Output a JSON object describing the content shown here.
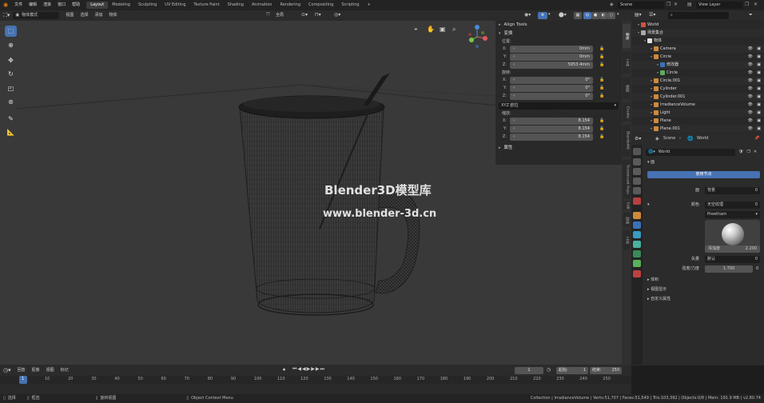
{
  "topbar": {
    "menus": [
      "文件",
      "编辑",
      "渲染",
      "窗口",
      "帮助"
    ],
    "workspaces": [
      "Layout",
      "Modeling",
      "Sculpting",
      "UV Editing",
      "Texture Paint",
      "Shading",
      "Animation",
      "Rendering",
      "Compositing",
      "Scripting"
    ],
    "active_workspace": "Layout",
    "add_tab": "+",
    "scene": "Scene",
    "view_layer": "View Layer"
  },
  "viewport_header": {
    "mode": "物体模式",
    "menus": [
      "视图",
      "选择",
      "添加",
      "物体"
    ],
    "orientation": "全局"
  },
  "npanel": {
    "align_tools": "Align Tools",
    "transform_title": "变换",
    "location_label": "位置:",
    "location": [
      {
        "axis": "X:",
        "value": "0mm"
      },
      {
        "axis": "Y:",
        "value": "0mm"
      },
      {
        "axis": "Z:",
        "value": "5953.4mm"
      }
    ],
    "rotation_label": "旋转:",
    "rotation": [
      {
        "axis": "X:",
        "value": "0°"
      },
      {
        "axis": "Y:",
        "value": "0°"
      },
      {
        "axis": "Z:",
        "value": "0°"
      }
    ],
    "rotation_mode": "XYZ 欧拉",
    "scale_label": "缩放:",
    "scale": [
      {
        "axis": "X:",
        "value": "8.154"
      },
      {
        "axis": "Y:",
        "value": "8.154"
      },
      {
        "axis": "Z:",
        "value": "8.154"
      }
    ],
    "properties_title": "属性"
  },
  "side_tabs": [
    "物体",
    "工具",
    "视图",
    "Create",
    "Blenderkit",
    "Screencast Keys",
    "Edit",
    "动画",
    "工具"
  ],
  "watermark": {
    "line1": "Blender3D模型库",
    "line2": "www.blender-3d.cn"
  },
  "outliner": {
    "rows": [
      {
        "label": "World",
        "indent": 0
      },
      {
        "label": "场景集合",
        "indent": 0
      },
      {
        "label": "物体",
        "indent": 1
      },
      {
        "label": "Camera",
        "indent": 2
      },
      {
        "label": "Circle",
        "indent": 2
      },
      {
        "label": "修改器",
        "indent": 3
      },
      {
        "label": "Circle",
        "indent": 3
      },
      {
        "label": "Circle.001",
        "indent": 2
      },
      {
        "label": "Cylinder",
        "indent": 2
      },
      {
        "label": "Cylinder.001",
        "indent": 2
      },
      {
        "label": "IrradianceVolume",
        "indent": 2
      },
      {
        "label": "Light",
        "indent": 2
      },
      {
        "label": "Plane",
        "indent": 2
      },
      {
        "label": "Plane.001",
        "indent": 2
      }
    ]
  },
  "properties": {
    "breadcrumb_scene": "Scene",
    "breadcrumb_world": "World",
    "world_name": "World",
    "surface_section": "面",
    "use_nodes": "使用节点",
    "surface_label": "面",
    "surface_value": "背景",
    "color_label": "颜色",
    "color_value": "天空纹理",
    "sky_type": "Preetham",
    "turbidity_label": "浑浊度",
    "turbidity_value": "2.200",
    "vector_label": "矢量",
    "vector_value": "默认",
    "strength_label": "强度/力度",
    "strength_value": "1.700",
    "zero": "0",
    "sections": [
      "体积",
      "视图显示",
      "自定义属性"
    ]
  },
  "timeline": {
    "menus": [
      "回放",
      "抠像",
      "视图",
      "标记"
    ],
    "current_frame": "1",
    "start_label": "起始:",
    "start": "1",
    "end_label": "结束:",
    "end": "250",
    "ticks": [
      "1",
      "10",
      "20",
      "30",
      "40",
      "50",
      "60",
      "70",
      "80",
      "90",
      "100",
      "110",
      "120",
      "130",
      "140",
      "150",
      "160",
      "170",
      "180",
      "190",
      "200",
      "210",
      "220",
      "230",
      "240",
      "250"
    ]
  },
  "statusbar": {
    "select": "选择",
    "box_select": "框选",
    "rotate_view": "旋转视图",
    "context_menu": "Object Context Menu",
    "stats": "Collection | IrradianceVolume | Verts:51,707 | Faces:51,549 | Tris:103,392 | Objects:0/8 | Mem: 191.9 MB | v2.80.74"
  }
}
